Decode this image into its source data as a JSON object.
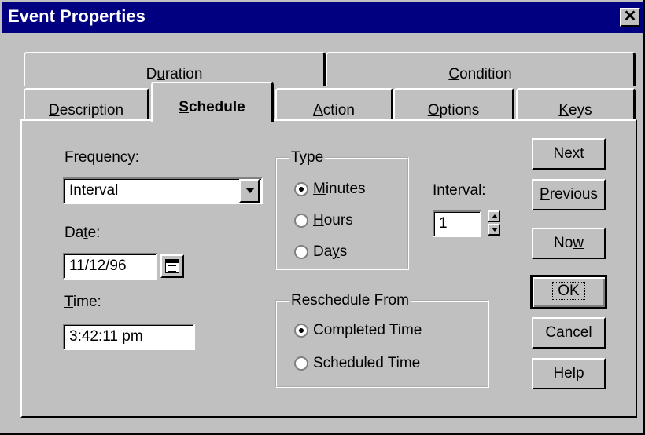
{
  "window": {
    "title": "Event Properties",
    "close_glyph": "✕"
  },
  "tabs": {
    "row1": [
      {
        "pre": "D",
        "acc": "u",
        "post": "ration"
      },
      {
        "pre": "",
        "acc": "C",
        "post": "ondition"
      }
    ],
    "row2": [
      {
        "pre": "",
        "acc": "D",
        "post": "escription"
      },
      {
        "pre": "",
        "acc": "S",
        "post": "chedule",
        "active": true
      },
      {
        "pre": "",
        "acc": "A",
        "post": "ction"
      },
      {
        "pre": "",
        "acc": "O",
        "post": "ptions"
      },
      {
        "pre": "",
        "acc": "K",
        "post": "eys"
      }
    ]
  },
  "schedule": {
    "frequency_label": {
      "acc": "F",
      "post": "requency:"
    },
    "frequency_value": "Interval",
    "date_label": {
      "pre": "Da",
      "acc": "t",
      "post": "e:"
    },
    "date_value": "11/12/96",
    "time_label": {
      "acc": "T",
      "post": "ime:"
    },
    "time_value": "3:42:11 pm",
    "type_group": {
      "title": "Type",
      "options": [
        {
          "acc": "M",
          "post": "inutes",
          "selected": true
        },
        {
          "acc": "H",
          "post": "ours",
          "selected": false
        },
        {
          "pre": "Da",
          "acc": "y",
          "post": "s",
          "selected": false
        }
      ]
    },
    "interval_label": {
      "acc": "I",
      "post": "nterval:"
    },
    "interval_value": "1",
    "reschedule_group": {
      "title": "Reschedule From",
      "options": [
        {
          "label": "Completed Time",
          "selected": true
        },
        {
          "label": "Scheduled Time",
          "selected": false
        }
      ]
    }
  },
  "buttons": {
    "next": {
      "acc": "N",
      "post": "ext"
    },
    "previous": {
      "acc": "P",
      "post": "revious"
    },
    "now": {
      "pre": "No",
      "acc": "w",
      "post": ""
    },
    "ok": "OK",
    "cancel": "Cancel",
    "help": "Help"
  }
}
